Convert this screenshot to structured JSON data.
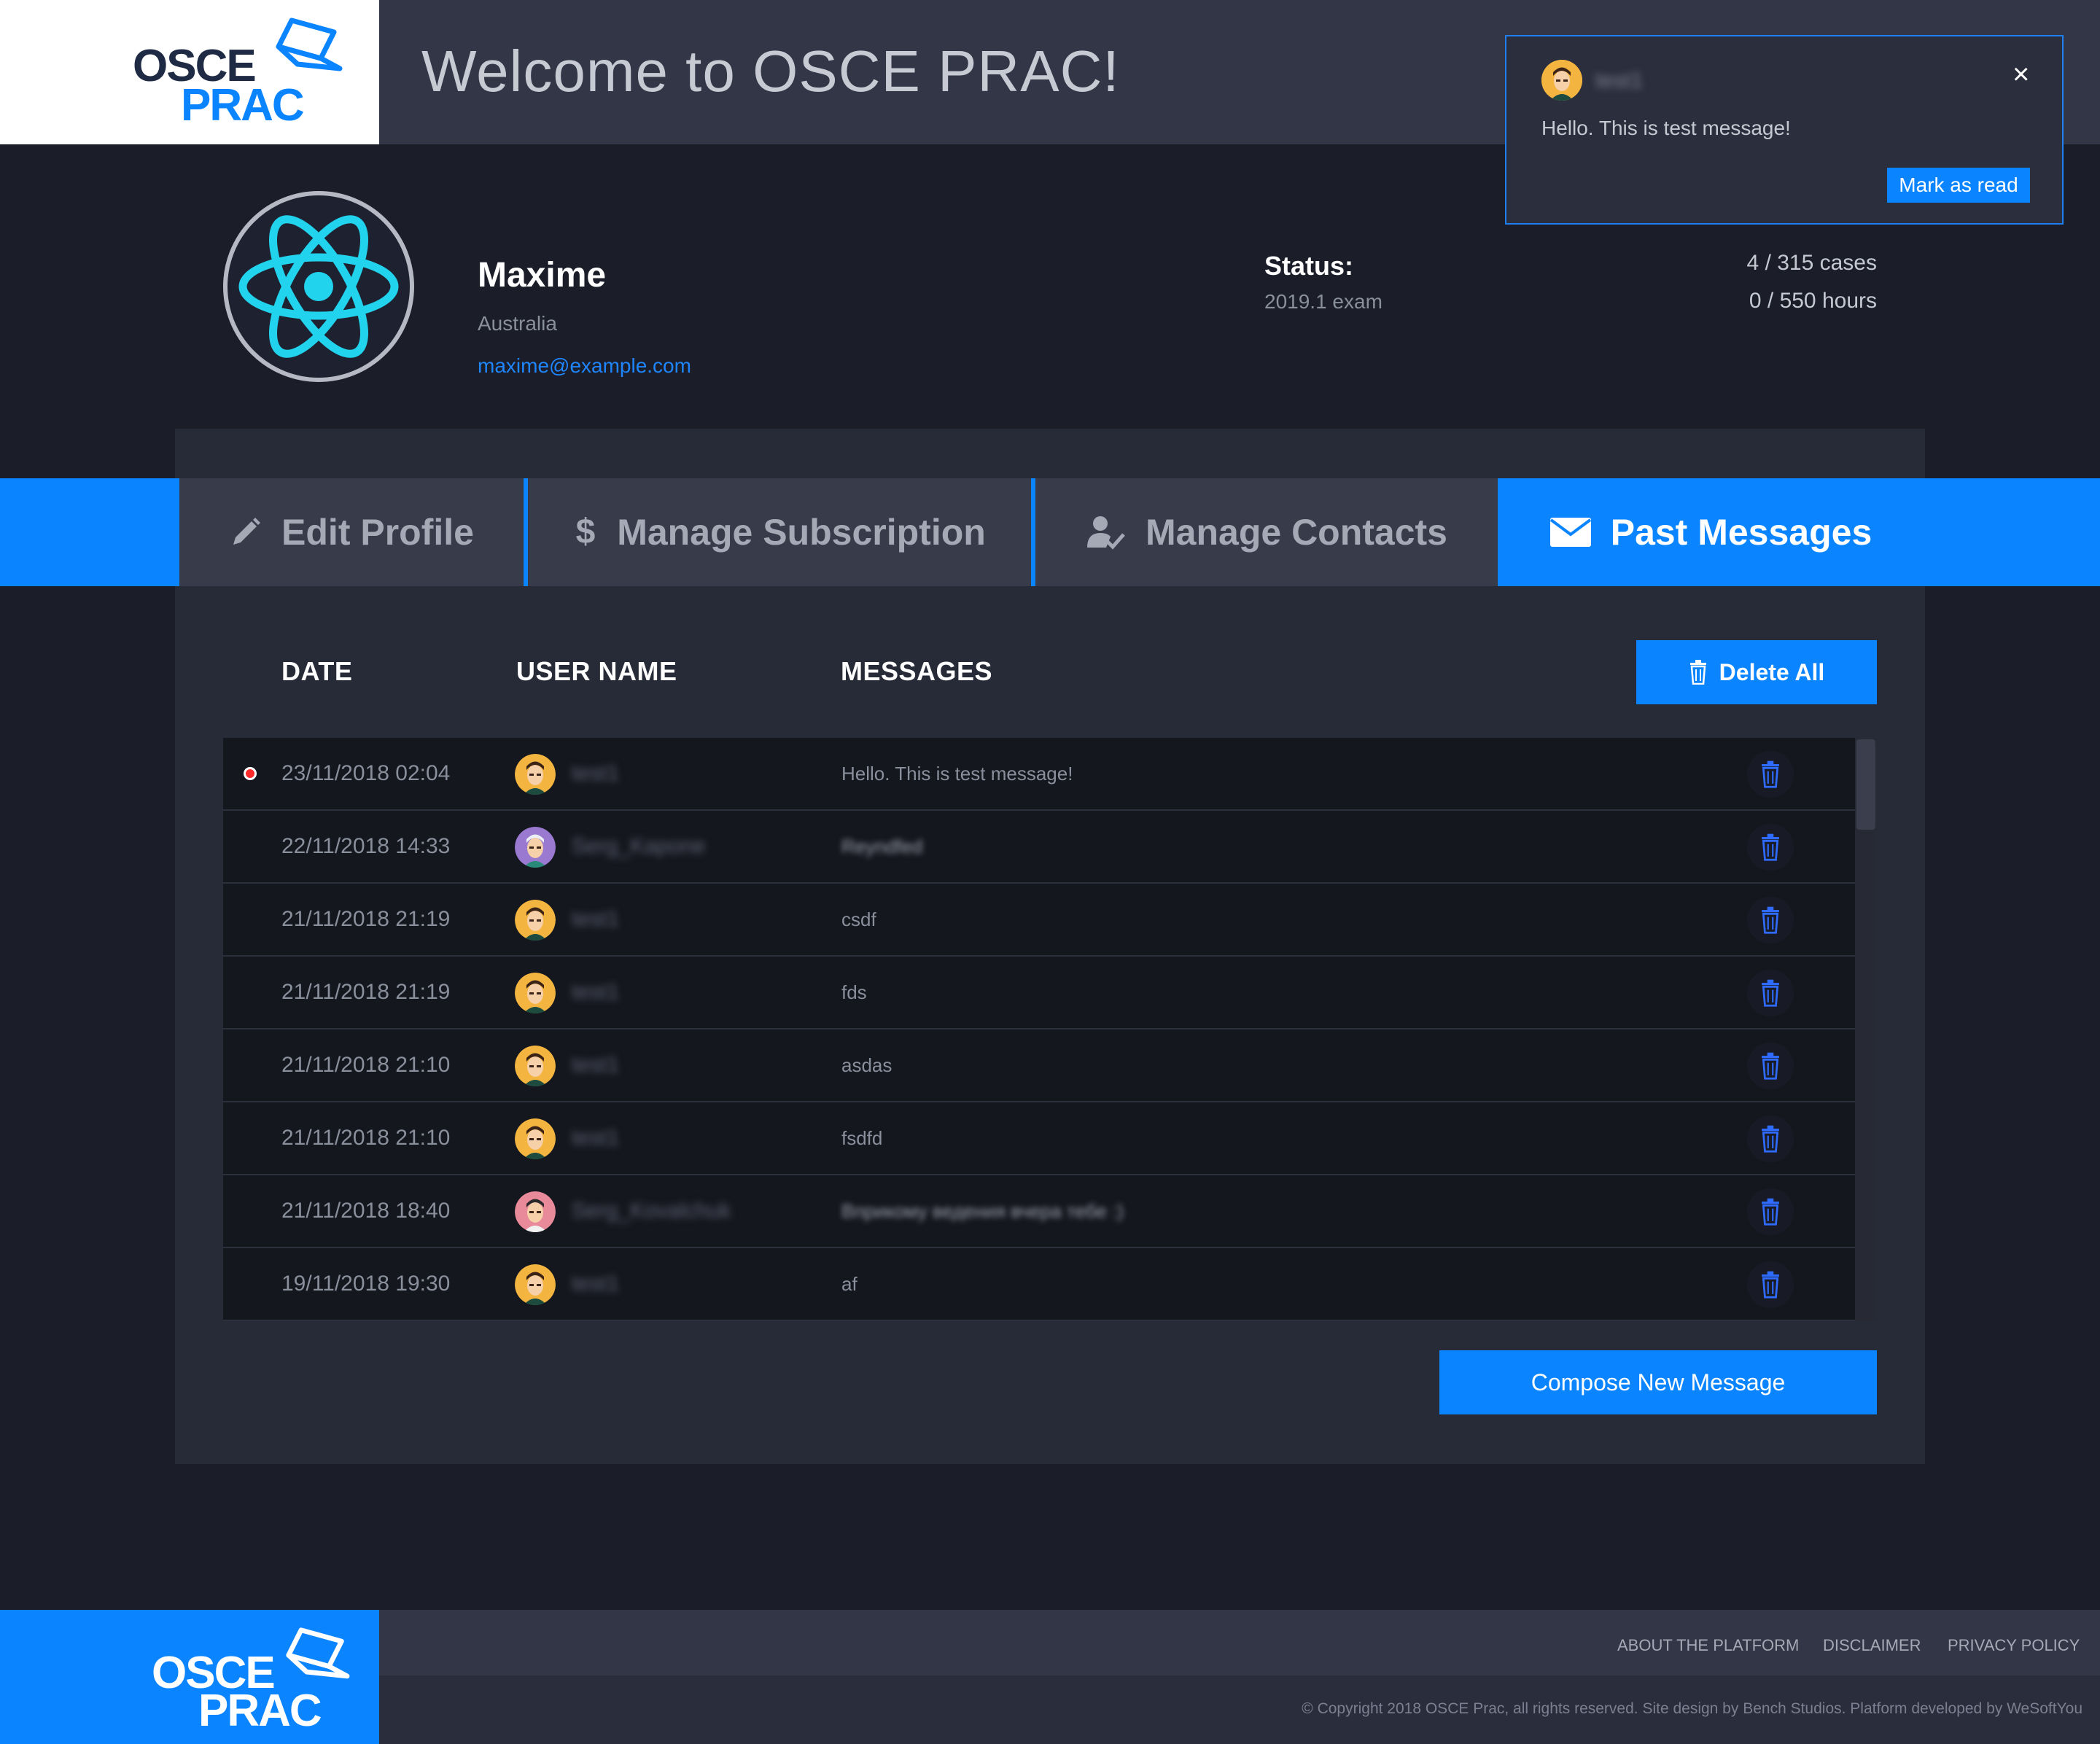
{
  "header": {
    "logo_line1": "OSCE",
    "logo_line2": "PRAC",
    "welcome": "Welcome to OSCE PRAC!"
  },
  "notification": {
    "user": "test1",
    "message": "Hello. This is test message!",
    "close_label": "×",
    "mark_read_label": "Mark as read"
  },
  "profile": {
    "name": "Maxime",
    "country": "Australia",
    "email": "maxime@example.com",
    "status_label": "Status:",
    "status_value": "2019.1 exam",
    "cases": "4 / 315 cases",
    "hours": "0 / 550 hours"
  },
  "tabs": [
    {
      "label": "Edit Profile",
      "icon": "pencil-icon"
    },
    {
      "label": "Manage Subscription",
      "icon": "dollar-icon"
    },
    {
      "label": "Manage Contacts",
      "icon": "user-check-icon"
    },
    {
      "label": "Past Messages",
      "icon": "envelope-icon",
      "active": true
    }
  ],
  "table": {
    "col_date": "DATE",
    "col_user": "USER NAME",
    "col_messages": "MESSAGES",
    "delete_all_label": "Delete All",
    "rows": [
      {
        "date": "23/11/2018 02:04",
        "user": "test1",
        "message": "Hello. This is test message!",
        "unread": true,
        "avatar": "face-orange",
        "blurred": false
      },
      {
        "date": "22/11/2018 14:33",
        "user": "Serg_Kapone",
        "message": "Reyndfed",
        "unread": false,
        "avatar": "face-purple",
        "blurred": true
      },
      {
        "date": "21/11/2018 21:19",
        "user": "test1",
        "message": "csdf",
        "unread": false,
        "avatar": "face-orange",
        "blurred": false
      },
      {
        "date": "21/11/2018 21:19",
        "user": "test1",
        "message": "fds",
        "unread": false,
        "avatar": "face-orange",
        "blurred": false
      },
      {
        "date": "21/11/2018 21:10",
        "user": "test1",
        "message": "asdas",
        "unread": false,
        "avatar": "face-orange",
        "blurred": false
      },
      {
        "date": "21/11/2018 21:10",
        "user": "test1",
        "message": "fsdfd",
        "unread": false,
        "avatar": "face-orange",
        "blurred": false
      },
      {
        "date": "21/11/2018 18:40",
        "user": "Serg_Kovalchuk",
        "message": "Вприкому ведения вчера тебе :)",
        "unread": false,
        "avatar": "face-pink",
        "blurred": true
      },
      {
        "date": "19/11/2018 19:30",
        "user": "test1",
        "message": "af",
        "unread": false,
        "avatar": "face-orange",
        "blurred": false
      }
    ]
  },
  "compose_label": "Compose New Message",
  "footer": {
    "links": [
      "ABOUT THE PLATFORM",
      "DISCLAIMER",
      "PRIVACY POLICY"
    ],
    "copyright": "© Copyright 2018 OSCE Prac, all rights reserved. Site design by Bench Studios. Platform developed by WeSoftYou"
  },
  "colors": {
    "accent": "#0a84ff",
    "background": "#1b1d28",
    "panel": "#272a37",
    "unread_dot": "#ff2b2b"
  }
}
